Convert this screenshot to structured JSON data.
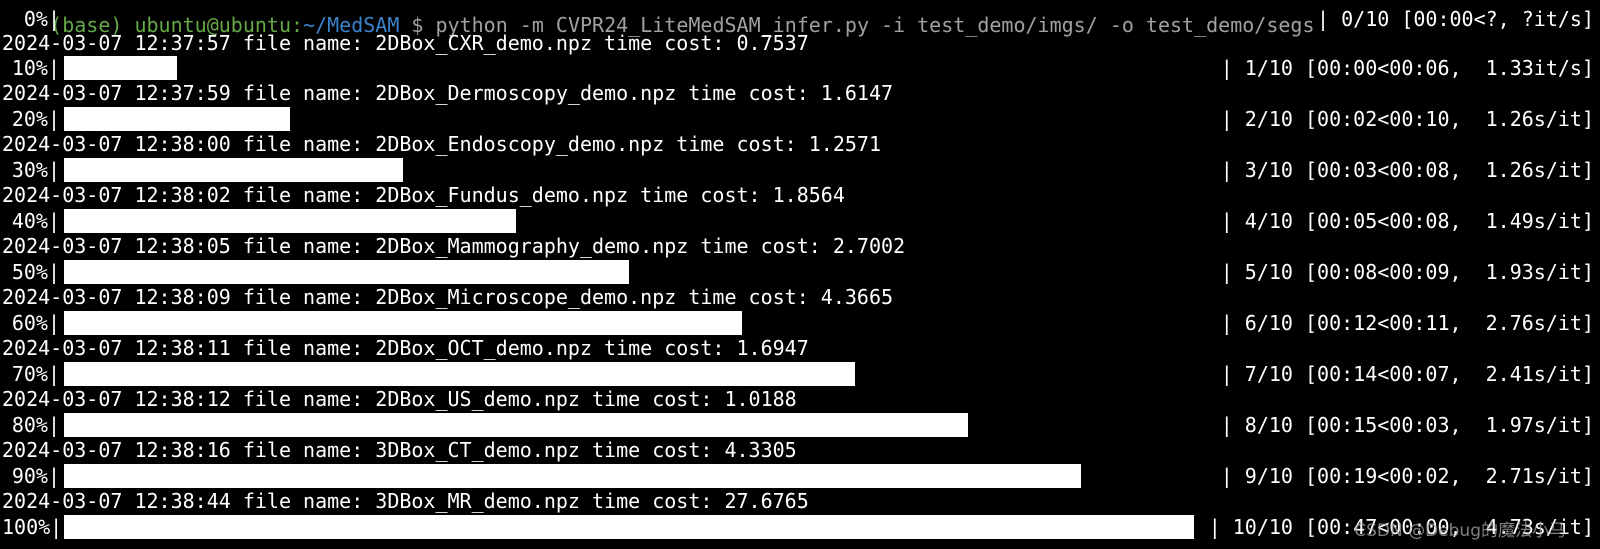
{
  "window": {
    "prompt": {
      "user": "(base) ubuntu@ubuntu:",
      "path": "~/MedSAM",
      "command": "$ python -m CVPR24_LiteMedSAM_infer.py -i test_demo/imgs/ -o test_demo/segs"
    }
  },
  "colors": {
    "background": "#000000",
    "text": "#ffffff",
    "bar_fill": "#ffffff",
    "prompt_user": "#7fd35a",
    "prompt_path": "#4aa3ff"
  },
  "progress": [
    {
      "percent_label": "0%|",
      "fraction": 0.0,
      "stats": "| 0/10 [00:00<?, ?it/s]"
    },
    {
      "percent_label": "10%|",
      "fraction": 0.1,
      "stats": "| 1/10 [00:00<00:06,  1.33it/s]"
    },
    {
      "percent_label": "20%|",
      "fraction": 0.2,
      "stats": "| 2/10 [00:02<00:10,  1.26s/it]"
    },
    {
      "percent_label": "30%|",
      "fraction": 0.3,
      "stats": "| 3/10 [00:03<00:08,  1.26s/it]"
    },
    {
      "percent_label": "40%|",
      "fraction": 0.4,
      "stats": "| 4/10 [00:05<00:08,  1.49s/it]"
    },
    {
      "percent_label": "50%|",
      "fraction": 0.5,
      "stats": "| 5/10 [00:08<00:09,  1.93s/it]"
    },
    {
      "percent_label": "60%|",
      "fraction": 0.6,
      "stats": "| 6/10 [00:12<00:11,  2.76s/it]"
    },
    {
      "percent_label": "70%|",
      "fraction": 0.7,
      "stats": "| 7/10 [00:14<00:07,  2.41s/it]"
    },
    {
      "percent_label": "80%|",
      "fraction": 0.8,
      "stats": "| 8/10 [00:15<00:03,  1.97s/it]"
    },
    {
      "percent_label": "90%|",
      "fraction": 0.9,
      "stats": "| 9/10 [00:19<00:02,  2.71s/it]"
    },
    {
      "percent_label": "100%|",
      "fraction": 1.0,
      "stats": "| 10/10 [00:47<00:00,  4.73s/it]"
    }
  ],
  "logs": [
    "2024-03-07 12:37:57 file name: 2DBox_CXR_demo.npz time cost: 0.7537",
    "2024-03-07 12:37:59 file name: 2DBox_Dermoscopy_demo.npz time cost: 1.6147",
    "2024-03-07 12:38:00 file name: 2DBox_Endoscopy_demo.npz time cost: 1.2571",
    "2024-03-07 12:38:02 file name: 2DBox_Fundus_demo.npz time cost: 1.8564",
    "2024-03-07 12:38:05 file name: 2DBox_Mammography_demo.npz time cost: 2.7002",
    "2024-03-07 12:38:09 file name: 2DBox_Microscope_demo.npz time cost: 4.3665",
    "2024-03-07 12:38:11 file name: 2DBox_OCT_demo.npz time cost: 1.6947",
    "2024-03-07 12:38:12 file name: 2DBox_US_demo.npz time cost: 1.0188",
    "2024-03-07 12:38:16 file name: 3DBox_CT_demo.npz time cost: 4.3305",
    "2024-03-07 12:38:44 file name: 3DBox_MR_demo.npz time cost: 27.6765"
  ],
  "watermark": "CSDN @Debug的魔法小马"
}
